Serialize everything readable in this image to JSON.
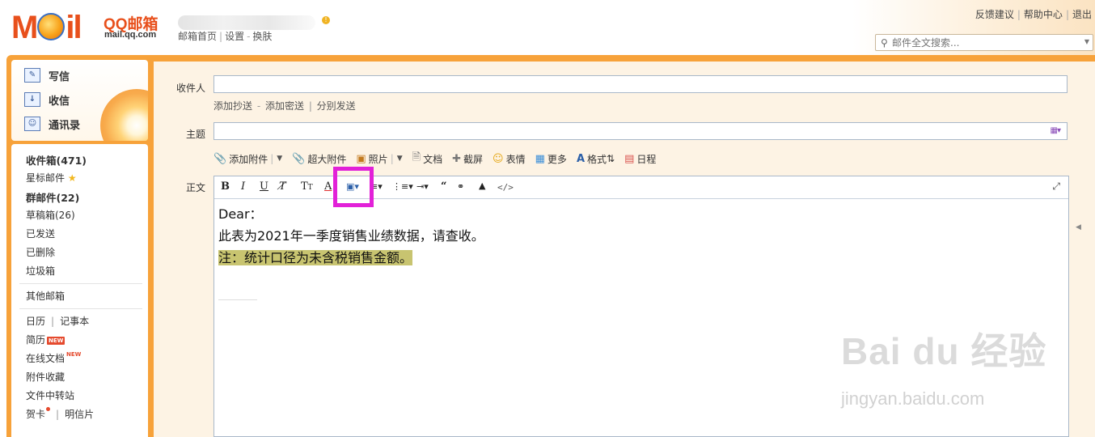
{
  "header": {
    "logo_text": "Mail",
    "logo_brand": "QQ邮箱",
    "logo_url": "mail.qq.com",
    "links": [
      "邮箱首页",
      "设置",
      "换肤"
    ],
    "top_right": [
      "反馈建议",
      "帮助中心",
      "退出"
    ],
    "search_placeholder": "邮件全文搜索..."
  },
  "sidebar": {
    "actions": [
      {
        "label": "写信",
        "icon": "pencil-paper-icon"
      },
      {
        "label": "收信",
        "icon": "inbox-download-icon"
      },
      {
        "label": "通讯录",
        "icon": "contacts-card-icon"
      }
    ],
    "folders": {
      "inbox": "收件箱(471)",
      "starred": "星标邮件",
      "group": "群邮件(22)",
      "drafts": "草稿箱(26)",
      "sent": "已发送",
      "deleted": "已删除",
      "spam": "垃圾箱",
      "other": "其他邮箱",
      "calendar": "日历",
      "notepad": "记事本",
      "resume": "简历",
      "online_docs": "在线文档",
      "attachments": "附件收藏",
      "transfer": "文件中转站",
      "cards": "贺卡",
      "postcards": "明信片",
      "new_badge": "NEW"
    }
  },
  "compose": {
    "to_label": "收件人",
    "to_value": "",
    "cc_links": [
      "添加抄送",
      "添加密送",
      "分别发送"
    ],
    "subject_label": "主题",
    "subject_value": "",
    "body_label": "正文",
    "toolbar": [
      "添加附件",
      "超大附件",
      "照片",
      "文档",
      "截屏",
      "表情",
      "更多",
      "格式",
      "日程"
    ],
    "body_lines": [
      "Dear：",
      "此表为2021年一季度销售业绩数据，请查收。",
      "注：统计口径为未含税销售金额。"
    ],
    "highlight_color": "#c8c470",
    "annotation_color": "#e221d8"
  },
  "watermark": {
    "brand": "Bai du 经验",
    "url": "jingyan.baidu.com"
  }
}
